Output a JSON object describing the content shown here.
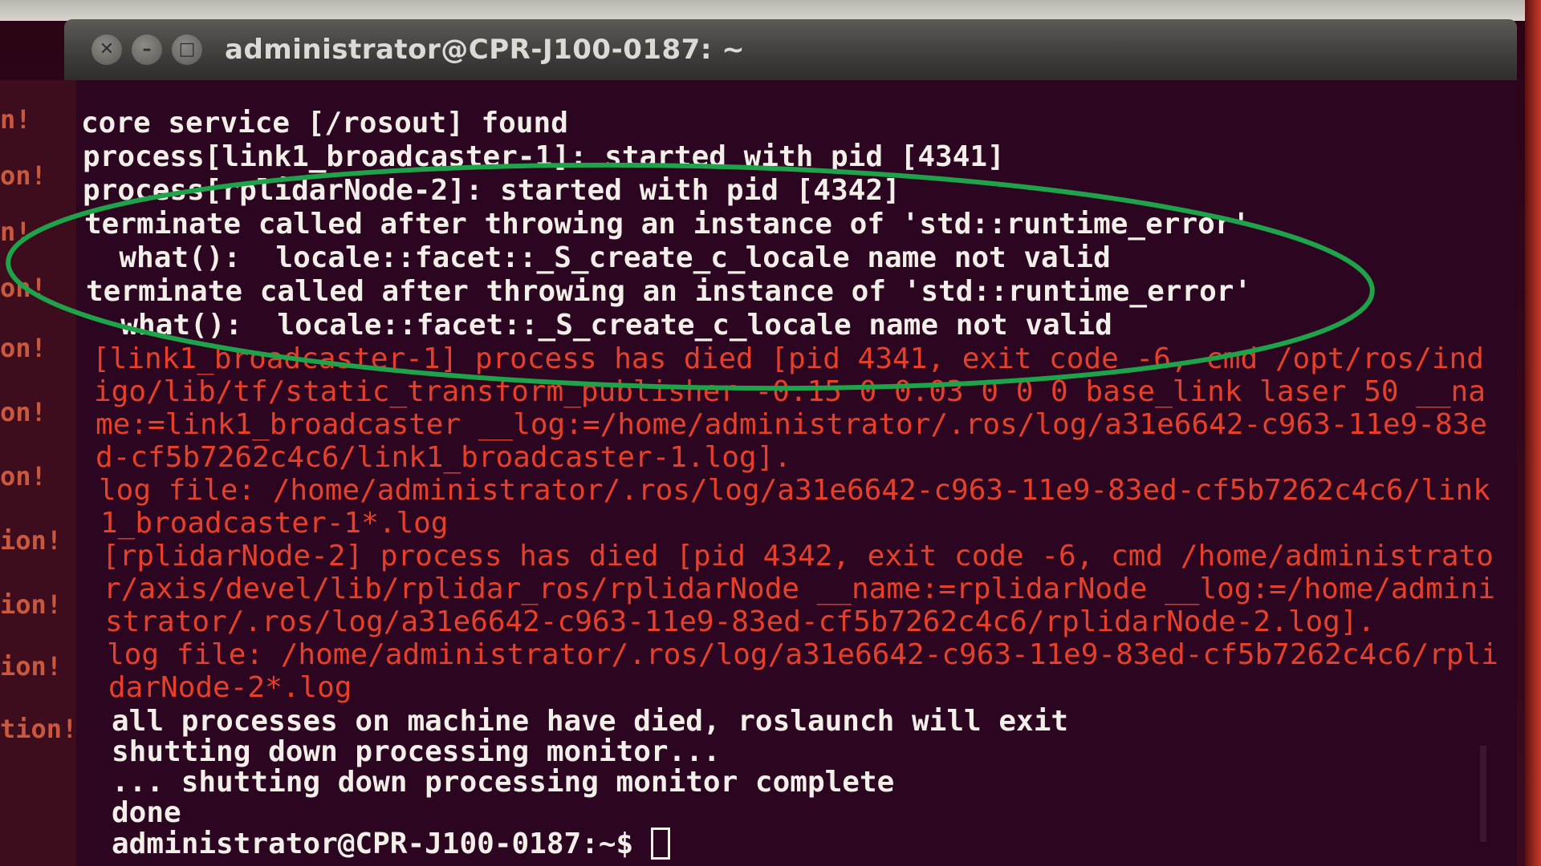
{
  "window": {
    "title": "administrator@CPR-J100-0187: ~",
    "controls": [
      "close-icon",
      "minimize-icon",
      "maximize-icon"
    ],
    "control_glyphs": [
      "✕",
      "–",
      "□"
    ]
  },
  "left_gutter": [
    "n!",
    "on!",
    "n!",
    "on!",
    "on!",
    "on!",
    "on!",
    "ion!",
    "ion!",
    "ion!",
    "tion!"
  ],
  "terminal": {
    "lines": [
      {
        "text": "core service [/rosout] found",
        "style": "w"
      },
      {
        "text": "process[link1_broadcaster-1]: started with pid [4341]",
        "style": "w"
      },
      {
        "text": "process[rplidarNode-2]: started with pid [4342]",
        "style": "w"
      },
      {
        "text": "terminate called after throwing an instance of 'std::runtime_error'",
        "style": "w"
      },
      {
        "text": "  what():  locale::facet::_S_create_c_locale name not valid",
        "style": "w"
      },
      {
        "text": "terminate called after throwing an instance of 'std::runtime_error'",
        "style": "w"
      },
      {
        "text": "  what():  locale::facet::_S_create_c_locale name not valid",
        "style": "w"
      },
      {
        "text": "[link1_broadcaster-1] process has died [pid 4341, exit code -6, cmd /opt/ros/ind",
        "style": "r"
      },
      {
        "text": "igo/lib/tf/static_transform_publisher -0.15 0 0.03 0 0 0 base_link laser 50 __na",
        "style": "r"
      },
      {
        "text": "me:=link1_broadcaster __log:=/home/administrator/.ros/log/a31e6642-c963-11e9-83e",
        "style": "r"
      },
      {
        "text": "d-cf5b7262c4c6/link1_broadcaster-1.log].",
        "style": "r"
      },
      {
        "text": "log file: /home/administrator/.ros/log/a31e6642-c963-11e9-83ed-cf5b7262c4c6/link",
        "style": "r"
      },
      {
        "text": "1_broadcaster-1*.log",
        "style": "r"
      },
      {
        "text": "[rplidarNode-2] process has died [pid 4342, exit code -6, cmd /home/administrato",
        "style": "r"
      },
      {
        "text": "r/axis/devel/lib/rplidar_ros/rplidarNode __name:=rplidarNode __log:=/home/admini",
        "style": "r"
      },
      {
        "text": "strator/.ros/log/a31e6642-c963-11e9-83ed-cf5b7262c4c6/rplidarNode-2.log].",
        "style": "r"
      },
      {
        "text": "log file: /home/administrator/.ros/log/a31e6642-c963-11e9-83ed-cf5b7262c4c6/rpli",
        "style": "r"
      },
      {
        "text": "darNode-2*.log",
        "style": "r"
      },
      {
        "text": "all processes on machine have died, roslaunch will exit",
        "style": "w"
      },
      {
        "text": "shutting down processing monitor...",
        "style": "w"
      },
      {
        "text": "... shutting down processing monitor complete",
        "style": "w"
      },
      {
        "text": "done",
        "style": "w"
      }
    ],
    "prompt": "administrator@CPR-J100-0187:~$ "
  },
  "annotation": {
    "shape": "ellipse",
    "color": "#1fa34a"
  }
}
